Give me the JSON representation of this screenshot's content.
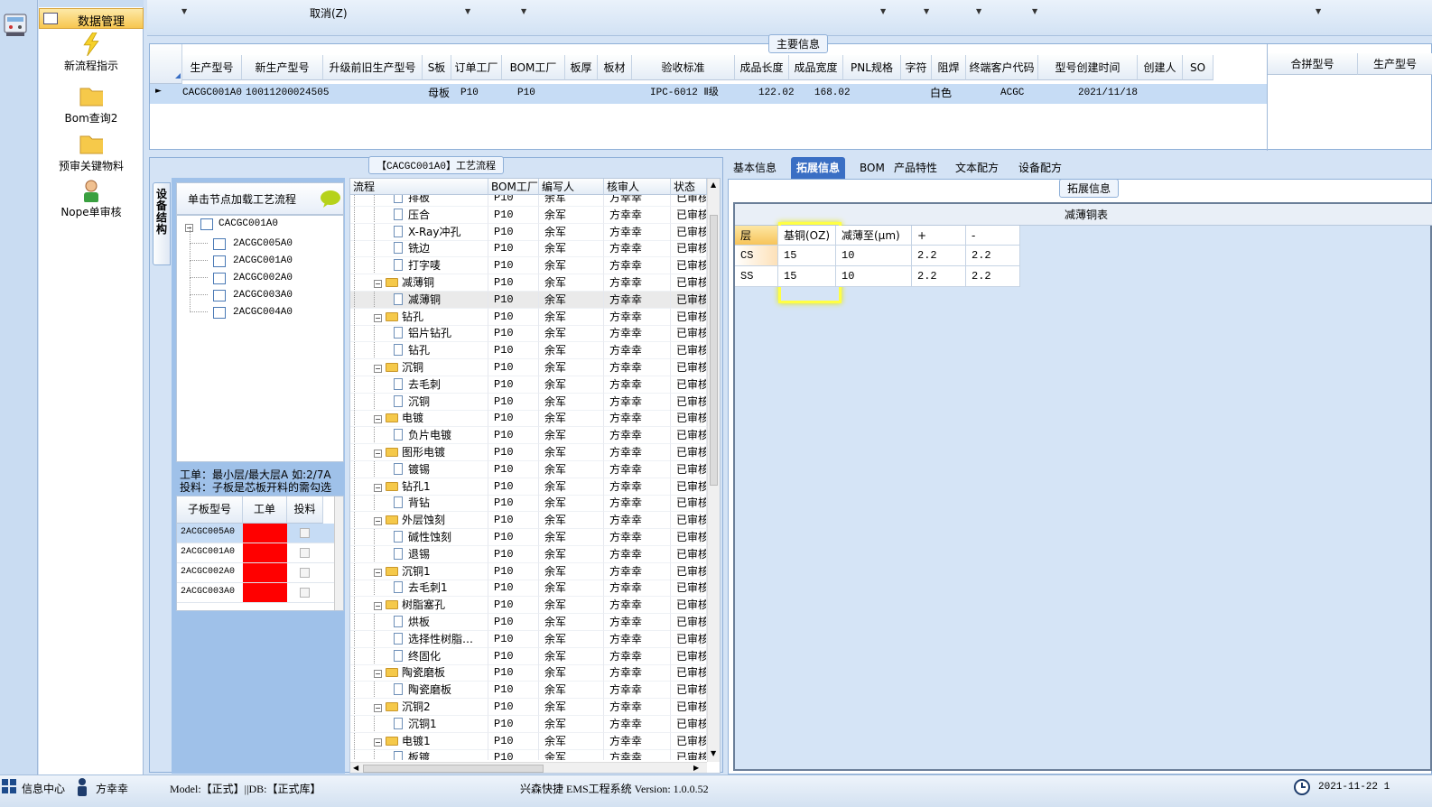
{
  "nav": {
    "items": [
      {
        "label": "数据管理"
      },
      {
        "label": "新流程指示"
      },
      {
        "label": "Bom查询2"
      },
      {
        "label": "预审关键物料"
      },
      {
        "label": "Nope单审核"
      }
    ]
  },
  "toolbar": {
    "cancel": "取消(Z)"
  },
  "main_info": {
    "title": "主要信息",
    "columns": [
      "生产型号",
      "新生产型号",
      "升级前旧生产型号",
      "S板",
      "订单工厂",
      "BOM工厂",
      "板厚",
      "板材",
      "验收标准",
      "成品长度",
      "成品宽度",
      "PNL规格",
      "字符",
      "阻焊",
      "终端客户代码",
      "型号创建时间",
      "创建人",
      "SO"
    ],
    "row": {
      "prod_model": "CACGC001A0",
      "new_model": "10011200024505",
      "s_board": "母板",
      "order_factory": "P10",
      "bom_factory": "P10",
      "standard": "IPC-6012 Ⅱ级",
      "length": "122.02",
      "width": "168.02",
      "char": "白色",
      "customer": "ACGC",
      "created": "2021/11/18"
    },
    "side_columns": [
      "合拼型号",
      "生产型号"
    ]
  },
  "process": {
    "title": "【CACGC001A0】工艺流程",
    "vertical_tab": "设备结构",
    "hint": "单击节点加载工艺流程",
    "root": "CACGC001A0",
    "children": [
      "2ACGC005A0",
      "2ACGC001A0",
      "2ACGC002A0",
      "2ACGC003A0",
      "2ACGC004A0"
    ],
    "note1": "工单：最小层/最大层A 如:2/7A",
    "note2": "投料：子板是芯板开料的需勾选",
    "sub_headers": [
      "子板型号",
      "工单",
      "投料"
    ],
    "sub_rows": [
      "2ACGC005A0",
      "2ACGC001A0",
      "2ACGC002A0",
      "2ACGC003A0"
    ]
  },
  "flow": {
    "headers": [
      "流程",
      "BOM工厂",
      "编写人",
      "核审人",
      "状态"
    ],
    "factory": "P10",
    "writer": "余军",
    "reviewer": "方幸幸",
    "status": "已审核",
    "rows": [
      {
        "name": "排板",
        "lvl": 2
      },
      {
        "name": "压合",
        "lvl": 2
      },
      {
        "name": "X-Ray冲孔",
        "lvl": 2
      },
      {
        "name": "铣边",
        "lvl": 2
      },
      {
        "name": "打字唛",
        "lvl": 2
      },
      {
        "name": "减薄铜",
        "lvl": 1
      },
      {
        "name": "减薄铜",
        "lvl": 2,
        "sel": true
      },
      {
        "name": "钻孔",
        "lvl": 1
      },
      {
        "name": "铝片钻孔",
        "lvl": 2
      },
      {
        "name": "钻孔",
        "lvl": 2
      },
      {
        "name": "沉铜",
        "lvl": 1
      },
      {
        "name": "去毛刺",
        "lvl": 2
      },
      {
        "name": "沉铜",
        "lvl": 2
      },
      {
        "name": "电镀",
        "lvl": 1
      },
      {
        "name": "负片电镀",
        "lvl": 2
      },
      {
        "name": "图形电镀",
        "lvl": 1
      },
      {
        "name": "镀锡",
        "lvl": 2
      },
      {
        "name": "钻孔1",
        "lvl": 1
      },
      {
        "name": "背钻",
        "lvl": 2
      },
      {
        "name": "外层蚀刻",
        "lvl": 1
      },
      {
        "name": "碱性蚀刻",
        "lvl": 2
      },
      {
        "name": "退锡",
        "lvl": 2
      },
      {
        "name": "沉铜1",
        "lvl": 1
      },
      {
        "name": "去毛刺1",
        "lvl": 2
      },
      {
        "name": "树脂塞孔",
        "lvl": 1
      },
      {
        "name": "烘板",
        "lvl": 2
      },
      {
        "name": "选择性树脂…",
        "lvl": 2
      },
      {
        "name": "终固化",
        "lvl": 2
      },
      {
        "name": "陶瓷磨板",
        "lvl": 1
      },
      {
        "name": "陶瓷磨板",
        "lvl": 2
      },
      {
        "name": "沉铜2",
        "lvl": 1
      },
      {
        "name": "沉铜1",
        "lvl": 2
      },
      {
        "name": "电镀1",
        "lvl": 1
      },
      {
        "name": "板镀",
        "lvl": 2
      }
    ]
  },
  "tabs": {
    "items": [
      "基本信息",
      "拓展信息",
      "BOM",
      "产品特性",
      "文本配方",
      "设备配方"
    ],
    "active": 1
  },
  "ext": {
    "title": "拓展信息",
    "table_title": "减薄铜表",
    "headers": [
      "层",
      "基铜(OZ)",
      "减薄至(μm)",
      "+",
      "-"
    ],
    "rows": [
      [
        "CS",
        "15",
        "10",
        "2.2",
        "2.2"
      ],
      [
        "SS",
        "15",
        "10",
        "2.2",
        "2.2"
      ]
    ]
  },
  "status": {
    "info_center": "信息中心",
    "user": "方幸幸",
    "model": "Model:【正式】||DB:【正式库】",
    "system": "兴森快捷 EMS工程系统 Version: 1.0.0.52",
    "datetime": "2021-11-22 1"
  },
  "colors": {
    "accent": "#3a6fc4",
    "highlight": "#ffff44",
    "selected_row": "#c6dcf5",
    "red_cell": "#ff0000"
  }
}
